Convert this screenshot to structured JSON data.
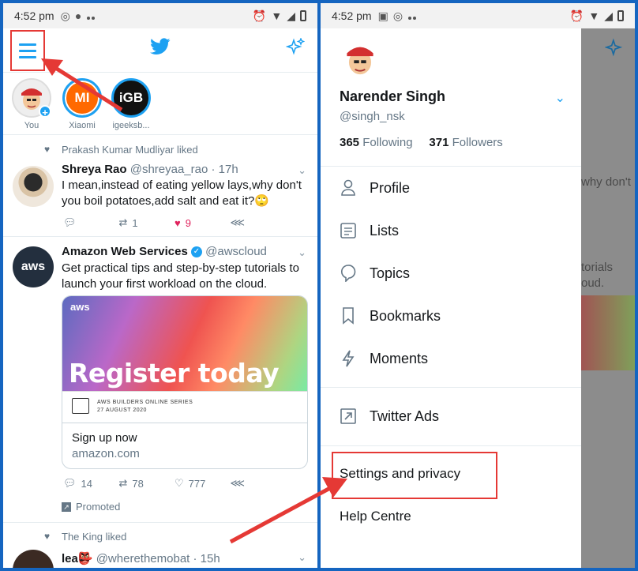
{
  "status_left": {
    "time": "4:52 pm"
  },
  "status_right": {
    "time": "4:52 pm"
  },
  "fleets": [
    {
      "label": "You"
    },
    {
      "label": "Xiaomi",
      "brand": "MI"
    },
    {
      "label": "igeeksb...",
      "brand": "iGB"
    }
  ],
  "tweets": [
    {
      "context": "Prakash Kumar Mudliyar liked",
      "name": "Shreya Rao",
      "handle": "@shreyaa_rao · 17h",
      "text": "I mean,instead of eating yellow lays,why don't you boil potatoes,add salt and eat it?🙄",
      "replies": "",
      "retweets": "1",
      "likes": "9"
    },
    {
      "name": "Amazon Web Services",
      "handle": "@awscloud",
      "avatar_text": "aws",
      "text": "Get practical tips and step-by-step tutorials to launch your first workload on the cloud.",
      "card": {
        "logo": "aws",
        "headline": "Register today",
        "series": "AWS BUILDERS ONLINE SERIES",
        "date": "27 AUGUST 2020",
        "title": "Sign up now",
        "domain": "amazon.com"
      },
      "replies": "14",
      "retweets": "78",
      "likes": "777",
      "promoted": "Promoted"
    },
    {
      "context": "The King liked",
      "name": "lea👺",
      "handle": "@wherethemobat · 15h"
    }
  ],
  "drawer": {
    "name": "Narender Singh",
    "handle": "@singh_nsk",
    "following_count": "365",
    "following_label": "Following",
    "followers_count": "371",
    "followers_label": "Followers",
    "items": [
      {
        "label": "Profile",
        "icon": "person-icon"
      },
      {
        "label": "Lists",
        "icon": "list-icon"
      },
      {
        "label": "Topics",
        "icon": "topics-icon"
      },
      {
        "label": "Bookmarks",
        "icon": "bookmark-icon"
      },
      {
        "label": "Moments",
        "icon": "lightning-icon"
      },
      {
        "label": "Twitter Ads",
        "icon": "external-arrow-icon"
      }
    ],
    "settings": "Settings and privacy",
    "help": "Help Centre"
  },
  "background_peek": {
    "line1": "why don't",
    "line2": "torials",
    "line3": "oud."
  },
  "colors": {
    "twitter_blue": "#1da1f2",
    "annotation_red": "#e53935",
    "like_red": "#e0245e",
    "frame_blue": "#1565c0"
  }
}
